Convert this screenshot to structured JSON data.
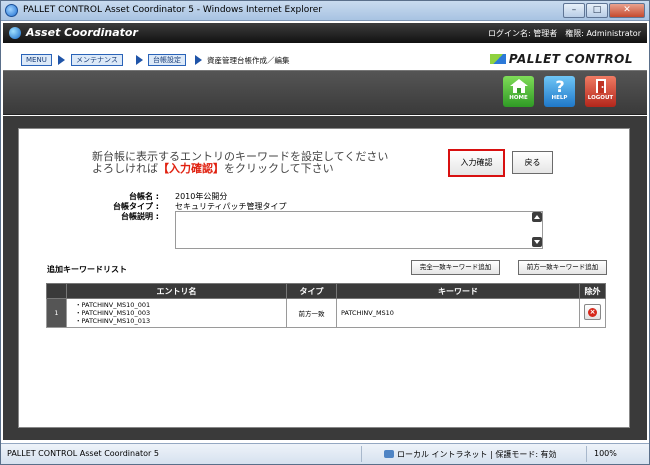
{
  "window": {
    "title": "PALLET CONTROL Asset Coordinator 5 - Windows Internet Explorer",
    "controls": [
      "–",
      "□",
      "✕"
    ]
  },
  "app": {
    "name": "Asset Coordinator",
    "login_text": "ログイン名: 管理者　権限: Administrator",
    "brand": "PALLET CONTROL"
  },
  "breadcrumb": {
    "items": [
      "MENU",
      "メンテナンス",
      "台帳設定"
    ],
    "current": "資産管理台帳作成／編集"
  },
  "toolbar": {
    "home": "HOME",
    "help": "HELP",
    "logout": "LOGOUT"
  },
  "guide": {
    "line1": "新台帳に表示するエントリのキーワードを設定してください",
    "line2_pre": "よろしければ",
    "line2_emph": "【入力確認】",
    "line2_post": "をクリックして下さい"
  },
  "buttons": {
    "confirm": "入力確認",
    "back": "戻る",
    "add_exact": "完全一致キーワード追加",
    "add_prefix": "前方一致キーワード追加"
  },
  "form": {
    "name_label": "台帳名",
    "name_value": "2010年公開分",
    "type_label": "台帳タイプ",
    "type_value": "セキュリティパッチ管理タイプ",
    "desc_label": "台帳説明"
  },
  "keyword_list": {
    "title": "追加キーワードリスト",
    "headers": [
      "エントリ名",
      "タイプ",
      "キーワード",
      "除外"
    ],
    "rows": [
      {
        "no": "1",
        "entries": [
          "・PATCHINV_MS10_001",
          "・PATCHINV_MS10_003",
          "・PATCHINV_MS10_013"
        ],
        "type": "前方一致",
        "keyword": "PATCHINV_MS10"
      }
    ]
  },
  "statusbar": {
    "left": "PALLET CONTROL Asset Coordinator 5",
    "zone": "ローカル イントラネット | 保護モード: 有効",
    "zoom": "100%"
  }
}
